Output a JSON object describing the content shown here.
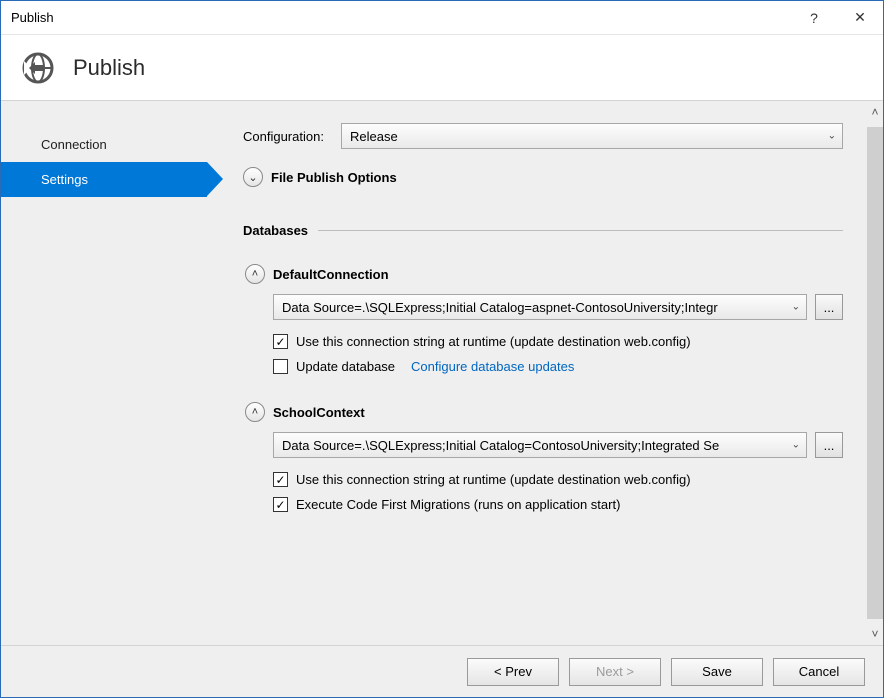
{
  "titlebar": {
    "title": "Publish"
  },
  "header": {
    "heading": "Publish"
  },
  "sidebar": {
    "items": [
      {
        "label": "Connection",
        "active": false
      },
      {
        "label": "Settings",
        "active": true
      }
    ]
  },
  "main": {
    "configLabel": "Configuration:",
    "configValue": "Release",
    "filePublishOptions": "File Publish Options",
    "databasesLabel": "Databases",
    "db": [
      {
        "name": "DefaultConnection",
        "connection": "Data Source=.\\SQLExpress;Initial Catalog=aspnet-ContosoUniversity;Integr",
        "useRuntime": {
          "checked": true,
          "label": "Use this connection string at runtime (update destination web.config)"
        },
        "updateDb": {
          "checked": false,
          "label": "Update database"
        },
        "configureLink": "Configure database updates"
      },
      {
        "name": "SchoolContext",
        "connection": "Data Source=.\\SQLExpress;Initial Catalog=ContosoUniversity;Integrated Se",
        "useRuntime": {
          "checked": true,
          "label": "Use this connection string at runtime (update destination web.config)"
        },
        "execMig": {
          "checked": true,
          "label": "Execute Code First Migrations (runs on application start)"
        }
      }
    ]
  },
  "footer": {
    "prev": "< Prev",
    "next": "Next >",
    "save": "Save",
    "cancel": "Cancel"
  },
  "glyph": {
    "chevDown": "⌄",
    "chevUp": "˄",
    "check": "✓",
    "ellipsis": "...",
    "help": "?",
    "close": "✕",
    "caretUp": "˄",
    "caretDown": "˅"
  }
}
